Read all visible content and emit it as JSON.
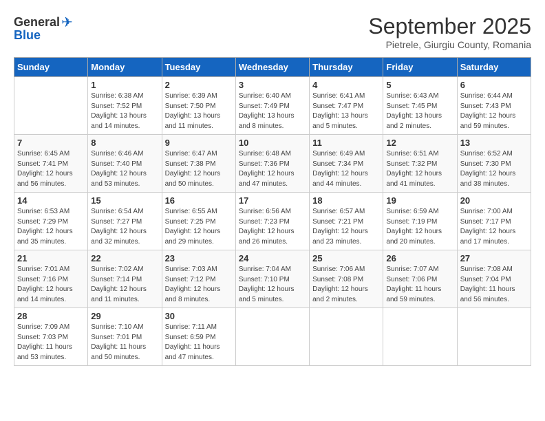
{
  "header": {
    "logo_general": "General",
    "logo_blue": "Blue",
    "month_title": "September 2025",
    "subtitle": "Pietrele, Giurgiu County, Romania"
  },
  "weekdays": [
    "Sunday",
    "Monday",
    "Tuesday",
    "Wednesday",
    "Thursday",
    "Friday",
    "Saturday"
  ],
  "weeks": [
    [
      {
        "day": "",
        "sunrise": "",
        "sunset": "",
        "daylight": ""
      },
      {
        "day": "1",
        "sunrise": "Sunrise: 6:38 AM",
        "sunset": "Sunset: 7:52 PM",
        "daylight": "Daylight: 13 hours and 14 minutes."
      },
      {
        "day": "2",
        "sunrise": "Sunrise: 6:39 AM",
        "sunset": "Sunset: 7:50 PM",
        "daylight": "Daylight: 13 hours and 11 minutes."
      },
      {
        "day": "3",
        "sunrise": "Sunrise: 6:40 AM",
        "sunset": "Sunset: 7:49 PM",
        "daylight": "Daylight: 13 hours and 8 minutes."
      },
      {
        "day": "4",
        "sunrise": "Sunrise: 6:41 AM",
        "sunset": "Sunset: 7:47 PM",
        "daylight": "Daylight: 13 hours and 5 minutes."
      },
      {
        "day": "5",
        "sunrise": "Sunrise: 6:43 AM",
        "sunset": "Sunset: 7:45 PM",
        "daylight": "Daylight: 13 hours and 2 minutes."
      },
      {
        "day": "6",
        "sunrise": "Sunrise: 6:44 AM",
        "sunset": "Sunset: 7:43 PM",
        "daylight": "Daylight: 12 hours and 59 minutes."
      }
    ],
    [
      {
        "day": "7",
        "sunrise": "Sunrise: 6:45 AM",
        "sunset": "Sunset: 7:41 PM",
        "daylight": "Daylight: 12 hours and 56 minutes."
      },
      {
        "day": "8",
        "sunrise": "Sunrise: 6:46 AM",
        "sunset": "Sunset: 7:40 PM",
        "daylight": "Daylight: 12 hours and 53 minutes."
      },
      {
        "day": "9",
        "sunrise": "Sunrise: 6:47 AM",
        "sunset": "Sunset: 7:38 PM",
        "daylight": "Daylight: 12 hours and 50 minutes."
      },
      {
        "day": "10",
        "sunrise": "Sunrise: 6:48 AM",
        "sunset": "Sunset: 7:36 PM",
        "daylight": "Daylight: 12 hours and 47 minutes."
      },
      {
        "day": "11",
        "sunrise": "Sunrise: 6:49 AM",
        "sunset": "Sunset: 7:34 PM",
        "daylight": "Daylight: 12 hours and 44 minutes."
      },
      {
        "day": "12",
        "sunrise": "Sunrise: 6:51 AM",
        "sunset": "Sunset: 7:32 PM",
        "daylight": "Daylight: 12 hours and 41 minutes."
      },
      {
        "day": "13",
        "sunrise": "Sunrise: 6:52 AM",
        "sunset": "Sunset: 7:30 PM",
        "daylight": "Daylight: 12 hours and 38 minutes."
      }
    ],
    [
      {
        "day": "14",
        "sunrise": "Sunrise: 6:53 AM",
        "sunset": "Sunset: 7:29 PM",
        "daylight": "Daylight: 12 hours and 35 minutes."
      },
      {
        "day": "15",
        "sunrise": "Sunrise: 6:54 AM",
        "sunset": "Sunset: 7:27 PM",
        "daylight": "Daylight: 12 hours and 32 minutes."
      },
      {
        "day": "16",
        "sunrise": "Sunrise: 6:55 AM",
        "sunset": "Sunset: 7:25 PM",
        "daylight": "Daylight: 12 hours and 29 minutes."
      },
      {
        "day": "17",
        "sunrise": "Sunrise: 6:56 AM",
        "sunset": "Sunset: 7:23 PM",
        "daylight": "Daylight: 12 hours and 26 minutes."
      },
      {
        "day": "18",
        "sunrise": "Sunrise: 6:57 AM",
        "sunset": "Sunset: 7:21 PM",
        "daylight": "Daylight: 12 hours and 23 minutes."
      },
      {
        "day": "19",
        "sunrise": "Sunrise: 6:59 AM",
        "sunset": "Sunset: 7:19 PM",
        "daylight": "Daylight: 12 hours and 20 minutes."
      },
      {
        "day": "20",
        "sunrise": "Sunrise: 7:00 AM",
        "sunset": "Sunset: 7:17 PM",
        "daylight": "Daylight: 12 hours and 17 minutes."
      }
    ],
    [
      {
        "day": "21",
        "sunrise": "Sunrise: 7:01 AM",
        "sunset": "Sunset: 7:16 PM",
        "daylight": "Daylight: 12 hours and 14 minutes."
      },
      {
        "day": "22",
        "sunrise": "Sunrise: 7:02 AM",
        "sunset": "Sunset: 7:14 PM",
        "daylight": "Daylight: 12 hours and 11 minutes."
      },
      {
        "day": "23",
        "sunrise": "Sunrise: 7:03 AM",
        "sunset": "Sunset: 7:12 PM",
        "daylight": "Daylight: 12 hours and 8 minutes."
      },
      {
        "day": "24",
        "sunrise": "Sunrise: 7:04 AM",
        "sunset": "Sunset: 7:10 PM",
        "daylight": "Daylight: 12 hours and 5 minutes."
      },
      {
        "day": "25",
        "sunrise": "Sunrise: 7:06 AM",
        "sunset": "Sunset: 7:08 PM",
        "daylight": "Daylight: 12 hours and 2 minutes."
      },
      {
        "day": "26",
        "sunrise": "Sunrise: 7:07 AM",
        "sunset": "Sunset: 7:06 PM",
        "daylight": "Daylight: 11 hours and 59 minutes."
      },
      {
        "day": "27",
        "sunrise": "Sunrise: 7:08 AM",
        "sunset": "Sunset: 7:04 PM",
        "daylight": "Daylight: 11 hours and 56 minutes."
      }
    ],
    [
      {
        "day": "28",
        "sunrise": "Sunrise: 7:09 AM",
        "sunset": "Sunset: 7:03 PM",
        "daylight": "Daylight: 11 hours and 53 minutes."
      },
      {
        "day": "29",
        "sunrise": "Sunrise: 7:10 AM",
        "sunset": "Sunset: 7:01 PM",
        "daylight": "Daylight: 11 hours and 50 minutes."
      },
      {
        "day": "30",
        "sunrise": "Sunrise: 7:11 AM",
        "sunset": "Sunset: 6:59 PM",
        "daylight": "Daylight: 11 hours and 47 minutes."
      },
      {
        "day": "",
        "sunrise": "",
        "sunset": "",
        "daylight": ""
      },
      {
        "day": "",
        "sunrise": "",
        "sunset": "",
        "daylight": ""
      },
      {
        "day": "",
        "sunrise": "",
        "sunset": "",
        "daylight": ""
      },
      {
        "day": "",
        "sunrise": "",
        "sunset": "",
        "daylight": ""
      }
    ]
  ]
}
